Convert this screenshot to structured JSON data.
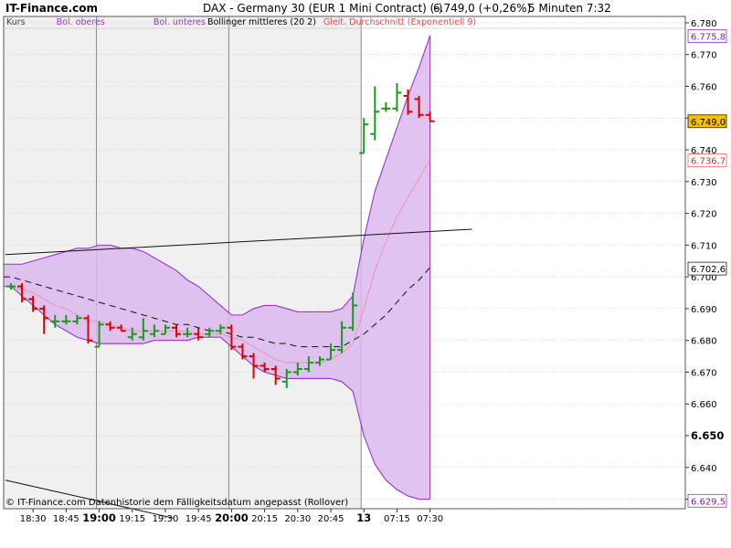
{
  "header": {
    "site": "IT-Finance.com",
    "instrument": "DAX - Germany 30 (EUR 1 Mini Contract) (-)",
    "price_change": "6.749,0 (+0,26%)",
    "interval_time": "5 Minuten  7:32"
  },
  "legend": [
    {
      "text": "Kurs",
      "color": "#444444"
    },
    {
      "text": "Bol. oberes",
      "color": "#9933cc"
    },
    {
      "text": "Bol. unteres",
      "color": "#9933cc"
    },
    {
      "text": "Bollinger mittleres (20 2)",
      "color": "#000000"
    },
    {
      "text": "Gleit. Durchschnitt (Exponentiell 9)",
      "color": "#e05050"
    }
  ],
  "copyright": "© IT-Finance.com  Datenhistorie dem Fälligkeitsdatum angepasst (Rollover)",
  "colors": {
    "plot_bg_gray": "#f0f0f0",
    "plot_bg_white": "#ffffff",
    "band_fill": "#dbb9ee",
    "band_line": "#9933cc",
    "ema": "#ee6666",
    "up": "#1a9a1a",
    "down": "#dd0000",
    "label_bg": "#ffffff",
    "last_price_bg": "#f6c000"
  },
  "chart_data": {
    "type": "ohlc",
    "ylim": [
      6627,
      6782
    ],
    "yticks": [
      {
        "value": 6780,
        "label": "6.780",
        "bold": false
      },
      {
        "value": 6770,
        "label": "6.770",
        "bold": false
      },
      {
        "value": 6760,
        "label": "6.760",
        "bold": false
      },
      {
        "value": 6750,
        "label": "6.750",
        "bold": false
      },
      {
        "value": 6740,
        "label": "6.740",
        "bold": false
      },
      {
        "value": 6730,
        "label": "6.730",
        "bold": false
      },
      {
        "value": 6720,
        "label": "6.720",
        "bold": false
      },
      {
        "value": 6710,
        "label": "6.710",
        "bold": false
      },
      {
        "value": 6700,
        "label": "6.700",
        "bold": false
      },
      {
        "value": 6690,
        "label": "6.690",
        "bold": false
      },
      {
        "value": 6680,
        "label": "6.680",
        "bold": false
      },
      {
        "value": 6670,
        "label": "6.670",
        "bold": false
      },
      {
        "value": 6660,
        "label": "6.660",
        "bold": false
      },
      {
        "value": 6650,
        "label": "6.650",
        "bold": true
      },
      {
        "value": 6640,
        "label": "6.640",
        "bold": false
      },
      {
        "value": 6630,
        "label": "6.630",
        "bold": false
      }
    ],
    "xticks": [
      {
        "index": 2,
        "label": "18:30",
        "bold": false
      },
      {
        "index": 5,
        "label": "18:45",
        "bold": false
      },
      {
        "index": 8,
        "label": "19:00",
        "bold": true
      },
      {
        "index": 11,
        "label": "19:15",
        "bold": false
      },
      {
        "index": 14,
        "label": "19:30",
        "bold": false
      },
      {
        "index": 17,
        "label": "19:45",
        "bold": false
      },
      {
        "index": 20,
        "label": "20:00",
        "bold": true
      },
      {
        "index": 23,
        "label": "20:15",
        "bold": false
      },
      {
        "index": 26,
        "label": "20:30",
        "bold": false
      },
      {
        "index": 29,
        "label": "20:45",
        "bold": false
      },
      {
        "index": 32,
        "label": "13",
        "bold": true
      },
      {
        "index": 35,
        "label": "07:15",
        "bold": false
      },
      {
        "index": 38,
        "label": "07:30",
        "bold": false
      }
    ],
    "vertical_lines": [
      8,
      20,
      32
    ],
    "session_break_index": 32,
    "ohlc": [
      [
        6697,
        6698,
        6696,
        6697
      ],
      [
        6697,
        6698,
        6692,
        6693
      ],
      [
        6693,
        6694,
        6689,
        6690
      ],
      [
        6690,
        6691,
        6682,
        6687
      ],
      [
        6686,
        6688,
        6684,
        6686
      ],
      [
        6686,
        6688,
        6685,
        6686
      ],
      [
        6686,
        6688,
        6685,
        6687
      ],
      [
        6687,
        6688,
        6679,
        6680
      ],
      [
        6678,
        6686,
        6678,
        6685
      ],
      [
        6685,
        6686,
        6683,
        6684
      ],
      [
        6684,
        6685,
        6683,
        6683
      ],
      [
        6681,
        6684,
        6680,
        6682
      ],
      [
        6681,
        6687,
        6680,
        6683
      ],
      [
        6682,
        6685,
        6681,
        6683
      ],
      [
        6682,
        6685,
        6682,
        6684
      ],
      [
        6684,
        6685,
        6681,
        6682
      ],
      [
        6682,
        6684,
        6681,
        6682
      ],
      [
        6682,
        6684,
        6680,
        6681
      ],
      [
        6682,
        6684,
        6681,
        6683
      ],
      [
        6683,
        6685,
        6682,
        6684
      ],
      [
        6684,
        6685,
        6677,
        6678
      ],
      [
        6678,
        6679,
        6674,
        6675
      ],
      [
        6675,
        6676,
        6668,
        6672
      ],
      [
        6672,
        6673,
        6670,
        6671
      ],
      [
        6671,
        6672,
        6666,
        6668
      ],
      [
        6667,
        6671,
        6665,
        6670
      ],
      [
        6670,
        6673,
        6669,
        6671
      ],
      [
        6671,
        6675,
        6670,
        6673
      ],
      [
        6673,
        6675,
        6672,
        6674
      ],
      [
        6674,
        6679,
        6674,
        6677
      ],
      [
        6677,
        6686,
        6676,
        6684
      ],
      [
        6684,
        6695,
        6683,
        6691
      ],
      [
        6739,
        6750,
        6739,
        6748
      ],
      [
        6745,
        6760,
        6743,
        6752
      ],
      [
        6753,
        6755,
        6752,
        6753
      ],
      [
        6753,
        6761,
        6752,
        6758
      ],
      [
        6757,
        6759,
        6751,
        6752
      ],
      [
        6756,
        6757,
        6750,
        6751
      ],
      [
        6751,
        6752,
        6749,
        6749
      ]
    ],
    "bollinger_upper": [
      6704,
      6704,
      6705,
      6706,
      6707,
      6708,
      6709,
      6709,
      6710,
      6710,
      6709,
      6709,
      6708,
      6706,
      6704,
      6702,
      6699,
      6697,
      6694,
      6691,
      6688,
      6688,
      6690,
      6691,
      6691,
      6690,
      6689,
      6689,
      6689,
      6689,
      6690,
      6694,
      6712,
      6727,
      6737,
      6747,
      6757,
      6766,
      6776
    ],
    "bollinger_middle": [
      6700,
      6699,
      6698,
      6697,
      6696,
      6695,
      6694,
      6693,
      6692,
      6691,
      6690,
      6689,
      6688,
      6687,
      6686,
      6685,
      6685,
      6684,
      6683,
      6683,
      6682,
      6681,
      6681,
      6680,
      6679,
      6679,
      6678,
      6678,
      6678,
      6678,
      6678,
      6680,
      6682,
      6685,
      6688,
      6692,
      6696,
      6699,
      6703
    ],
    "bollinger_lower": [
      6697,
      6694,
      6691,
      6688,
      6685,
      6683,
      6681,
      6680,
      6679,
      6679,
      6679,
      6679,
      6679,
      6680,
      6680,
      6680,
      6680,
      6681,
      6681,
      6681,
      6678,
      6675,
      6672,
      6670,
      6669,
      6668,
      6668,
      6668,
      6668,
      6668,
      6667,
      6664,
      6650,
      6641,
      6636,
      6633,
      6631,
      6630,
      6630
    ],
    "ema": [
      6697,
      6696,
      6695,
      6693,
      6691,
      6690,
      6688,
      6686,
      6686,
      6685,
      6684,
      6683,
      6683,
      6683,
      6683,
      6683,
      6683,
      6682,
      6682,
      6682,
      6681,
      6680,
      6678,
      6676,
      6674,
      6673,
      6673,
      6673,
      6673,
      6674,
      6676,
      6679,
      6690,
      6702,
      6711,
      6719,
      6725,
      6731,
      6737
    ],
    "trendlines": [
      {
        "from": [
          -0.5,
          6707
        ],
        "to": [
          41.8,
          6715
        ]
      },
      {
        "from": [
          -0.5,
          6636
        ],
        "to": [
          14.8,
          6624
        ]
      }
    ],
    "price_labels": [
      {
        "value": 6775.8,
        "label": "6.775,8",
        "kind": "band"
      },
      {
        "value": 6749.0,
        "label": "6.749,0",
        "kind": "last"
      },
      {
        "value": 6736.7,
        "label": "6.736,7",
        "kind": "ema"
      },
      {
        "value": 6702.6,
        "label": "6.702,6",
        "kind": "middle"
      },
      {
        "value": 6629.5,
        "label": "6.629,5",
        "kind": "band"
      }
    ]
  }
}
